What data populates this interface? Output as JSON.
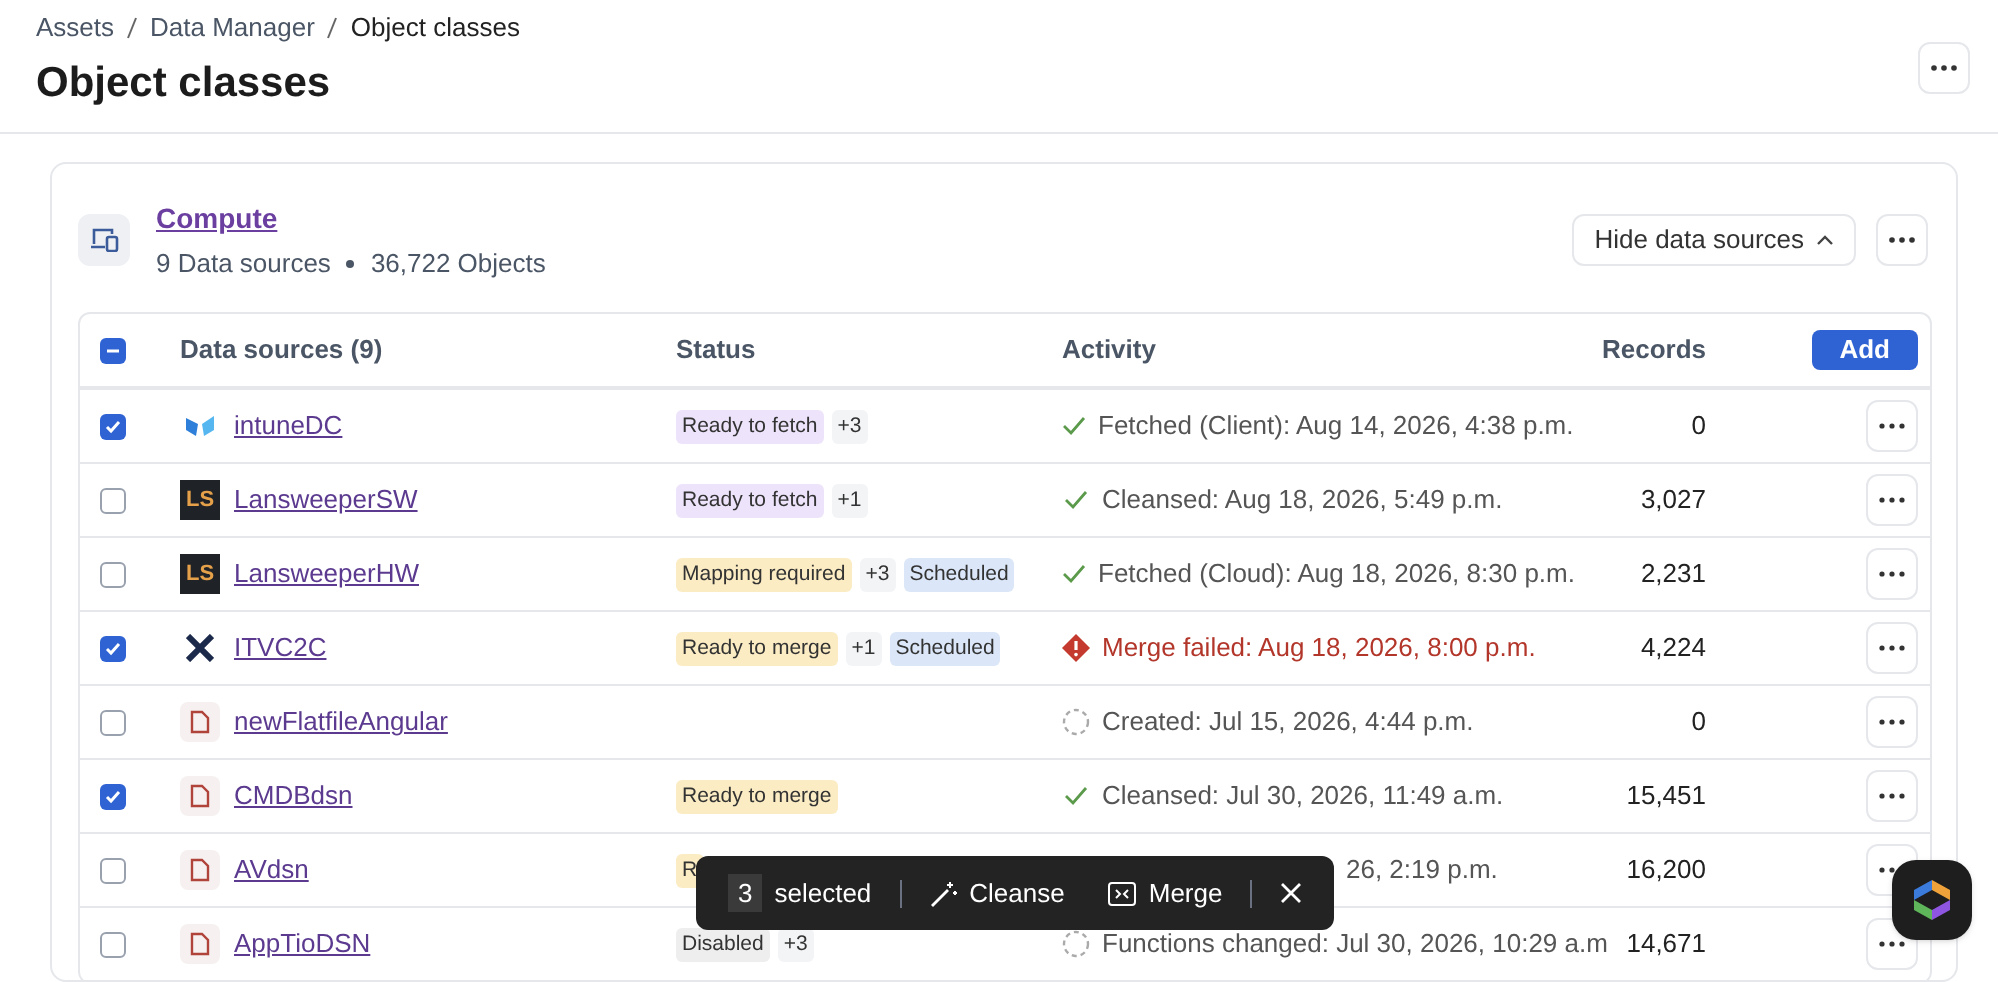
{
  "breadcrumbs": [
    "Assets",
    "Data Manager",
    "Object classes"
  ],
  "title": "Object classes",
  "card": {
    "name": "Compute",
    "sources": "9 Data sources",
    "objects": "36,722 Objects",
    "toggle": "Hide data sources"
  },
  "table": {
    "indeterminate": true,
    "columns": [
      "Data sources (9)",
      "Status",
      "Activity",
      "Records"
    ],
    "add": "Add",
    "rows": [
      {
        "selected": true,
        "logo": {
          "kind": "intune"
        },
        "name": "intuneDC",
        "tags": [
          {
            "label": "Ready to fetch",
            "color": "#ede4fb"
          },
          {
            "label": "+3",
            "color": "#f3f4f6"
          }
        ],
        "activity": {
          "kind": "check",
          "text": "Fetched (Client): Aug 14, 2026, 4:38 p.m."
        },
        "records": "0"
      },
      {
        "selected": false,
        "logo": {
          "kind": "ls",
          "text": "LS"
        },
        "name": "LansweeperSW",
        "tags": [
          {
            "label": "Ready to fetch",
            "color": "#ede4fb"
          },
          {
            "label": "+1",
            "color": "#f3f4f6"
          }
        ],
        "activity": {
          "kind": "check",
          "text": "Cleansed: Aug 18, 2026, 5:49 p.m."
        },
        "records": "3,027"
      },
      {
        "selected": false,
        "logo": {
          "kind": "ls",
          "text": "LS"
        },
        "name": "LansweeperHW",
        "tags": [
          {
            "label": "Mapping required",
            "color": "#fbecc4"
          },
          {
            "label": "+3",
            "color": "#f3f4f6"
          },
          {
            "label": "Scheduled",
            "color": "#dbe7f8"
          }
        ],
        "activity": {
          "kind": "check",
          "text": "Fetched (Cloud): Aug 18, 2026, 8:30 p.m."
        },
        "records": "2,231"
      },
      {
        "selected": true,
        "logo": {
          "kind": "x"
        },
        "name": "ITVC2C",
        "tags": [
          {
            "label": "Ready to merge",
            "color": "#fbecc4"
          },
          {
            "label": "+1",
            "color": "#f3f4f6"
          },
          {
            "label": "Scheduled",
            "color": "#dbe7f8"
          }
        ],
        "activity": {
          "kind": "error",
          "text": "Merge failed: Aug 18, 2026, 8:00 p.m."
        },
        "records": "4,224"
      },
      {
        "selected": false,
        "logo": {
          "kind": "file"
        },
        "name": "newFlatfileAngular",
        "activity": {
          "kind": "pending",
          "text": "Created: Jul 15, 2026, 4:44 p.m."
        },
        "records": "0"
      },
      {
        "selected": true,
        "logo": {
          "kind": "file"
        },
        "name": "CMDBdsn",
        "tags": [
          {
            "label": "Ready to merge",
            "color": "#fbecc4"
          }
        ],
        "activity": {
          "kind": "check",
          "text": "Cleansed: Jul 30, 2026, 11:49 a.m."
        },
        "records": "15,451"
      },
      {
        "selected": false,
        "logo": {
          "kind": "file"
        },
        "name": "AVdsn",
        "tags": [
          {
            "label": "R",
            "color": "#fbecc4"
          }
        ],
        "activity": {
          "kind": "covered",
          "text": "26, 2:19 p.m."
        },
        "records": "16,200"
      },
      {
        "selected": false,
        "logo": {
          "kind": "file"
        },
        "name": "AppTioDSN",
        "tags": [
          {
            "label": "Disabled",
            "color": "#eeeeee"
          },
          {
            "label": "+3",
            "color": "#f3f4f6"
          }
        ],
        "activity": {
          "kind": "pending",
          "text": "Functions changed: Jul 30, 2026, 10:29 a.m"
        },
        "records": "14,671"
      }
    ]
  },
  "selection_bar": {
    "count": "3",
    "label": "selected",
    "actions": [
      {
        "kind": "cleanse",
        "label": "Cleanse"
      },
      {
        "kind": "merge",
        "label": "Merge"
      }
    ]
  }
}
